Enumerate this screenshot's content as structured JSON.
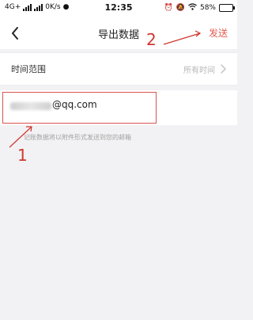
{
  "status_bar": {
    "network": "4G+",
    "speed": "0K/s",
    "time": "12:35",
    "battery": "58%",
    "battery_level": 0.58
  },
  "nav": {
    "title": "导出数据",
    "send_label": "发送",
    "back_icon": "chevron-left-icon"
  },
  "time_range": {
    "label": "时间范围",
    "value": "所有时间",
    "chevron_icon": "chevron-right-icon"
  },
  "email": {
    "value_suffix": "@qq.com"
  },
  "hint": "记账数据将以附件形式发送到您的邮箱",
  "annotations": {
    "step1": "1",
    "step2": "2"
  },
  "colors": {
    "accent": "#e25b52",
    "annotation": "#d0362f"
  }
}
